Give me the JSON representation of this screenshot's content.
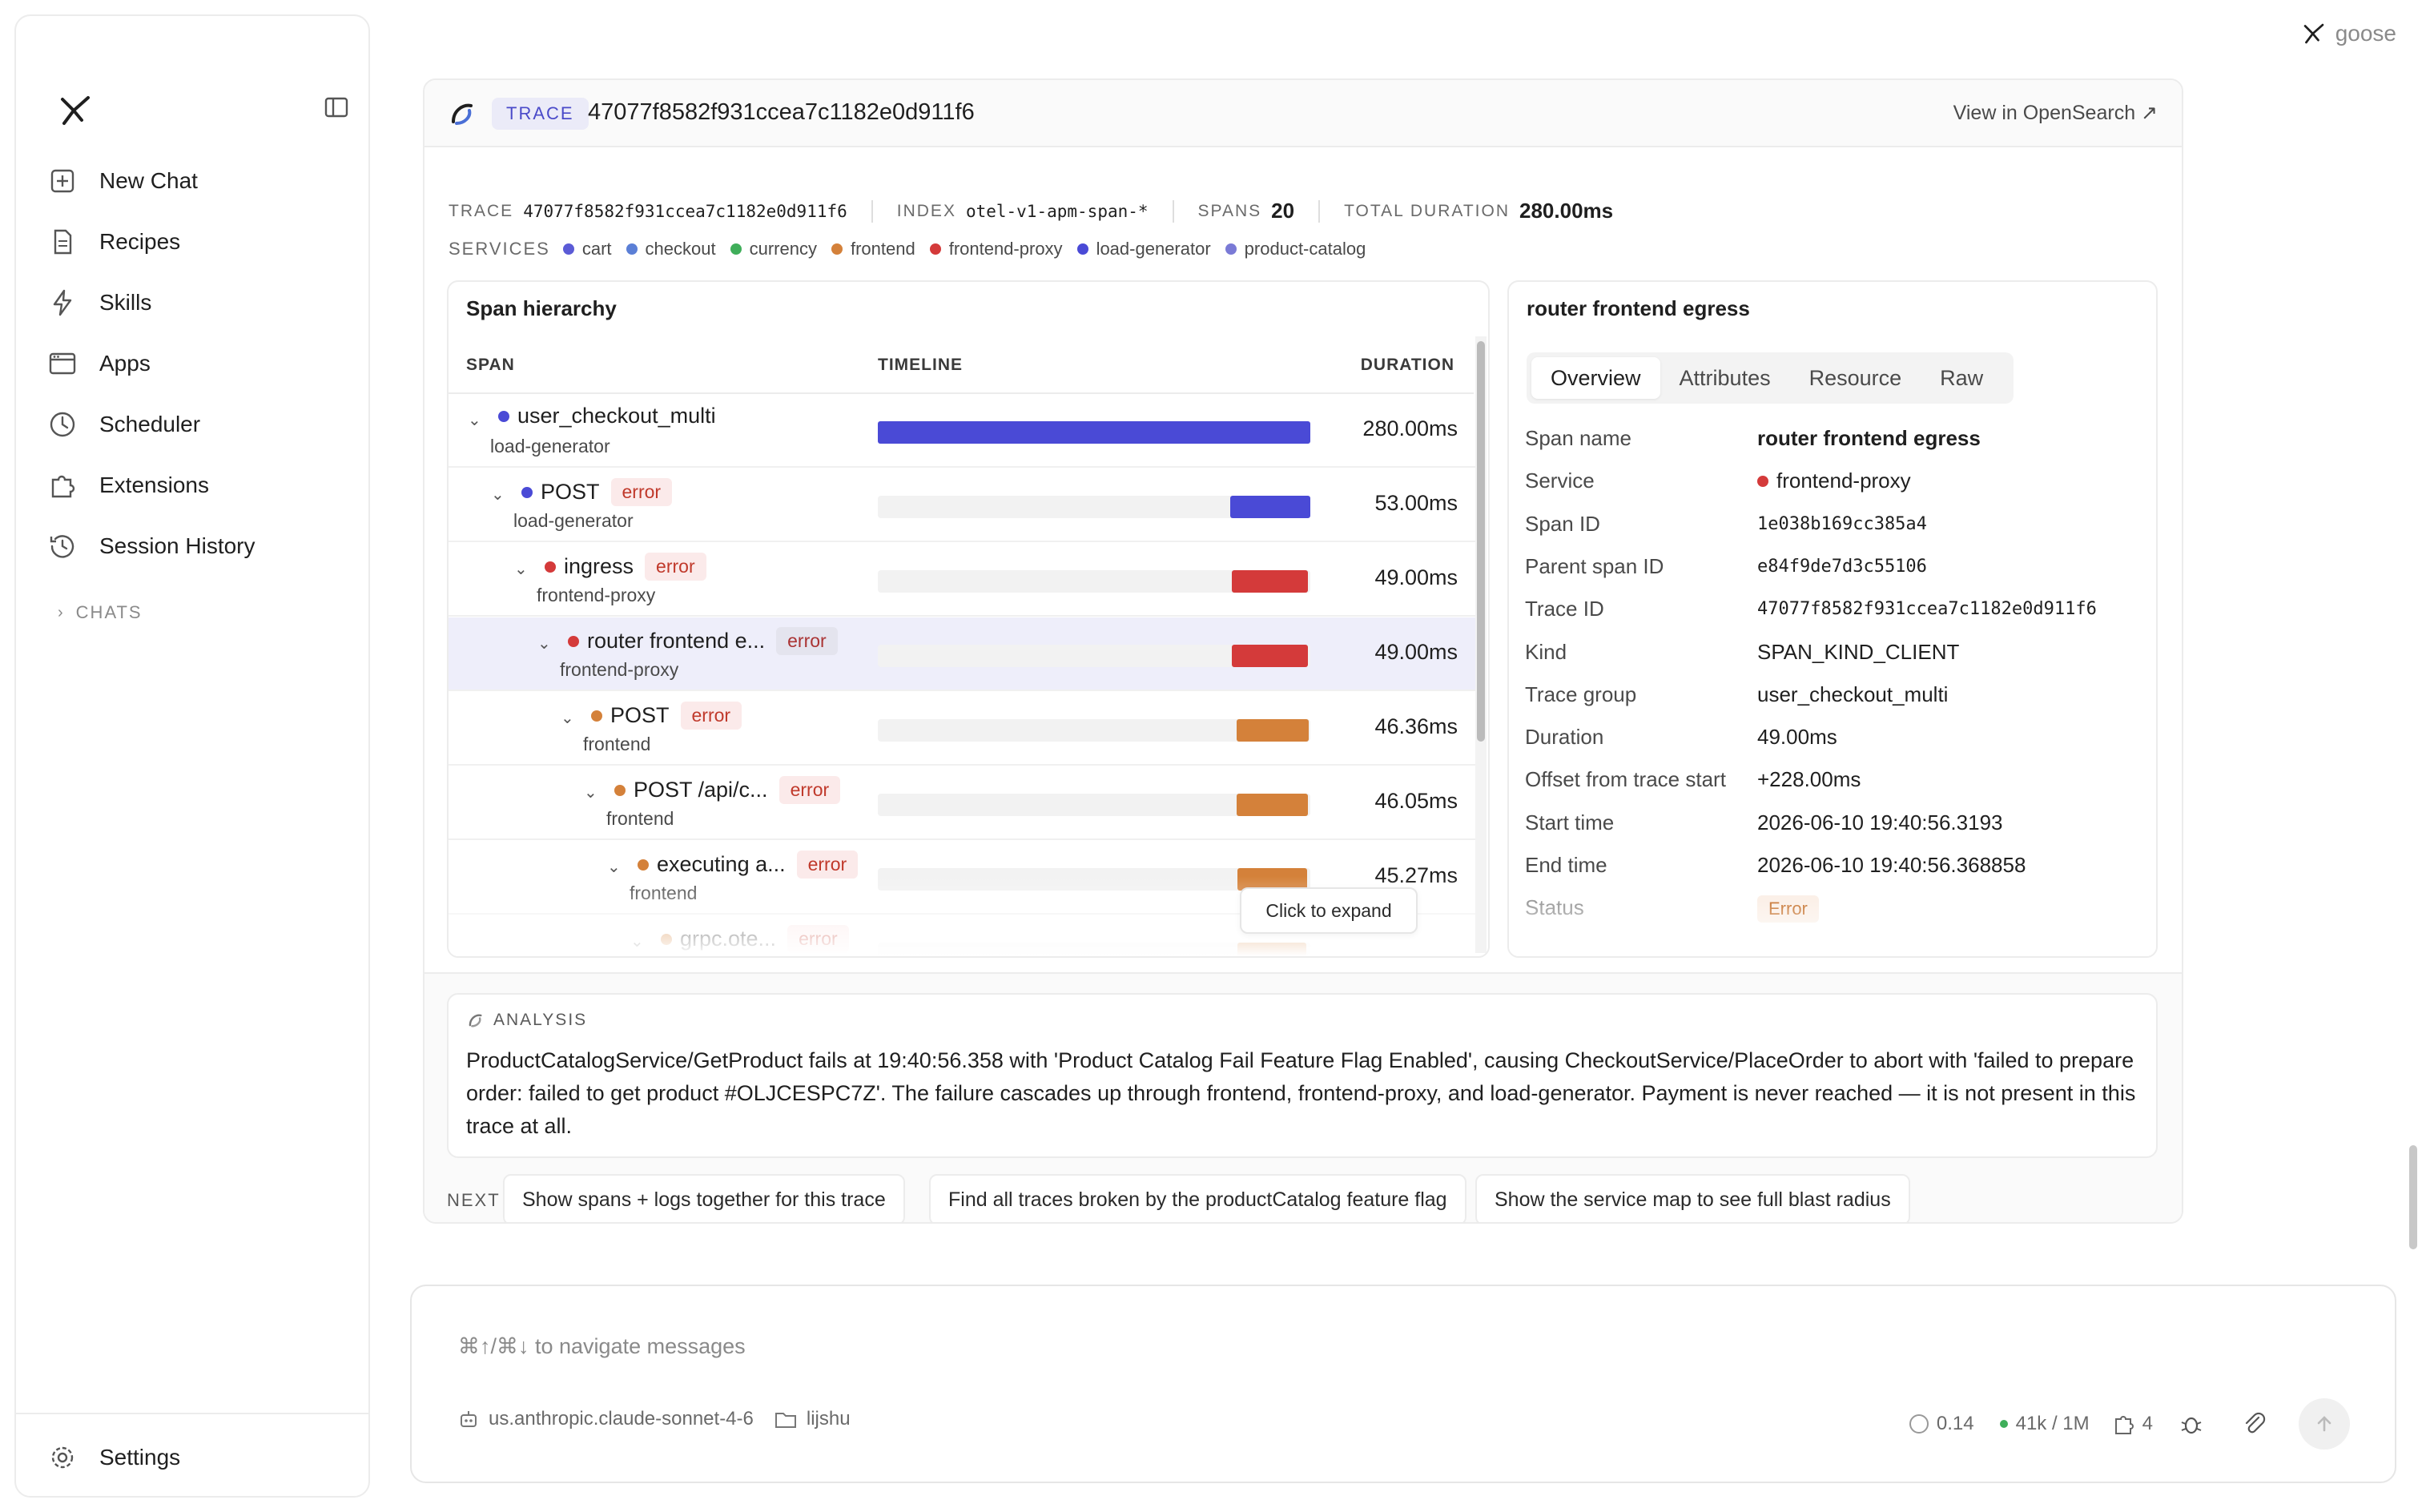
{
  "brand": {
    "name": "goose"
  },
  "sidebar": {
    "items": [
      {
        "label": "New Chat",
        "icon": "new-chat-icon"
      },
      {
        "label": "Recipes",
        "icon": "recipe-icon"
      },
      {
        "label": "Skills",
        "icon": "bolt-icon"
      },
      {
        "label": "Apps",
        "icon": "apps-icon"
      },
      {
        "label": "Scheduler",
        "icon": "clock-icon"
      },
      {
        "label": "Extensions",
        "icon": "puzzle-icon"
      },
      {
        "label": "Session History",
        "icon": "history-icon"
      }
    ],
    "chats_label": "CHATS",
    "settings_label": "Settings"
  },
  "trace": {
    "badge": "TRACE",
    "id": "47077f8582f931ccea7c1182e0d911f6",
    "view_link": "View in OpenSearch ↗",
    "meta": {
      "trace_key": "TRACE",
      "trace_val": "47077f8582f931ccea7c1182e0d911f6",
      "index_key": "INDEX",
      "index_val": "otel-v1-apm-span-*",
      "spans_key": "SPANS",
      "spans_val": "20",
      "duration_key": "TOTAL DURATION",
      "duration_val": "280.00ms"
    },
    "services_key": "SERVICES",
    "services": [
      {
        "name": "cart",
        "color": "#5b5bd6"
      },
      {
        "name": "checkout",
        "color": "#5b7fd6"
      },
      {
        "name": "currency",
        "color": "#3fae5a"
      },
      {
        "name": "frontend",
        "color": "#d4813a"
      },
      {
        "name": "frontend-proxy",
        "color": "#d43a3a"
      },
      {
        "name": "load-generator",
        "color": "#4a4ad6"
      },
      {
        "name": "product-catalog",
        "color": "#7a7ad6"
      }
    ]
  },
  "span_panel": {
    "title": "Span hierarchy",
    "col_span": "SPAN",
    "col_timeline": "TIMELINE",
    "col_duration": "DURATION",
    "tooltip": "Click to expand",
    "rows": [
      {
        "name": "user_checkout_multi",
        "service": "load-generator",
        "error": "",
        "duration": "280.00ms",
        "color": "#4a4ad6",
        "start": 0.0,
        "width": 1.0,
        "depth": 0,
        "selected": false
      },
      {
        "name": "POST",
        "service": "load-generator",
        "error": "error",
        "duration": "53.00ms",
        "color": "#4a4ad6",
        "start": 0.814,
        "width": 0.189,
        "depth": 1,
        "selected": false
      },
      {
        "name": "ingress",
        "service": "frontend-proxy",
        "error": "error",
        "duration": "49.00ms",
        "color": "#d43a3a",
        "start": 0.818,
        "width": 0.175,
        "depth": 2,
        "selected": false
      },
      {
        "name": "router frontend e...",
        "service": "frontend-proxy",
        "error": "error",
        "duration": "49.00ms",
        "color": "#d43a3a",
        "start": 0.818,
        "width": 0.175,
        "depth": 3,
        "selected": true
      },
      {
        "name": "POST",
        "service": "frontend",
        "error": "error",
        "duration": "46.36ms",
        "color": "#d4813a",
        "start": 0.829,
        "width": 0.166,
        "depth": 4,
        "selected": false
      },
      {
        "name": "POST /api/c...",
        "service": "frontend",
        "error": "error",
        "duration": "46.05ms",
        "color": "#d4813a",
        "start": 0.829,
        "width": 0.164,
        "depth": 5,
        "selected": false
      },
      {
        "name": "executing a...",
        "service": "frontend",
        "error": "error",
        "duration": "45.27ms",
        "color": "#d4813a",
        "start": 0.832,
        "width": 0.162,
        "depth": 6,
        "selected": false
      },
      {
        "name": "grpc.ote...",
        "service": "",
        "error": "error",
        "duration": "",
        "color": "#d4813a",
        "start": 0.832,
        "width": 0.16,
        "depth": 7,
        "selected": false
      }
    ]
  },
  "details": {
    "title": "router frontend egress",
    "tabs": [
      "Overview",
      "Attributes",
      "Resource",
      "Raw"
    ],
    "active_tab": "Overview",
    "fields": [
      {
        "key": "Span name",
        "value": "router frontend egress",
        "mono": false,
        "bold": true
      },
      {
        "key": "Service",
        "value": "frontend-proxy",
        "mono": false,
        "dot": "#d43a3a"
      },
      {
        "key": "Span ID",
        "value": "1e038b169cc385a4",
        "mono": true
      },
      {
        "key": "Parent span ID",
        "value": "e84f9de7d3c55106",
        "mono": true
      },
      {
        "key": "Trace ID",
        "value": "47077f8582f931ccea7c1182e0d911f6",
        "mono": true
      },
      {
        "key": "Kind",
        "value": "SPAN_KIND_CLIENT",
        "mono": false
      },
      {
        "key": "Trace group",
        "value": "user_checkout_multi",
        "mono": false
      },
      {
        "key": "Duration",
        "value": "49.00ms",
        "mono": false
      },
      {
        "key": "Offset from trace start",
        "value": "+228.00ms",
        "mono": false
      },
      {
        "key": "Start time",
        "value": "2026-06-10 19:40:56.3193",
        "mono": false
      },
      {
        "key": "End time",
        "value": "2026-06-10 19:40:56.368858",
        "mono": false
      },
      {
        "key": "Status",
        "value": "Error",
        "mono": false,
        "pill": true
      }
    ]
  },
  "analysis": {
    "label": "ANALYSIS",
    "text": "ProductCatalogService/GetProduct fails at 19:40:56.358 with 'Product Catalog Fail Feature Flag Enabled', causing CheckoutService/PlaceOrder to abort with 'failed to prepare order: failed to get product #OLJCESPC7Z'. The failure cascades up through frontend, frontend-proxy, and load-generator. Payment is never reached — it is not present in this trace at all."
  },
  "next": {
    "label": "NEXT",
    "suggestions": [
      "Show spans + logs together for this trace",
      "Find all traces broken by the productCatalog feature flag",
      "Show the service map to see full blast radius"
    ]
  },
  "composer": {
    "placeholder": "⌘↑/⌘↓ to navigate messages",
    "model": "us.anthropic.claude-sonnet-4-6",
    "folder": "lijshu",
    "cost": "0.14",
    "tokens": "41k / 1M",
    "extensions_count": "4"
  }
}
